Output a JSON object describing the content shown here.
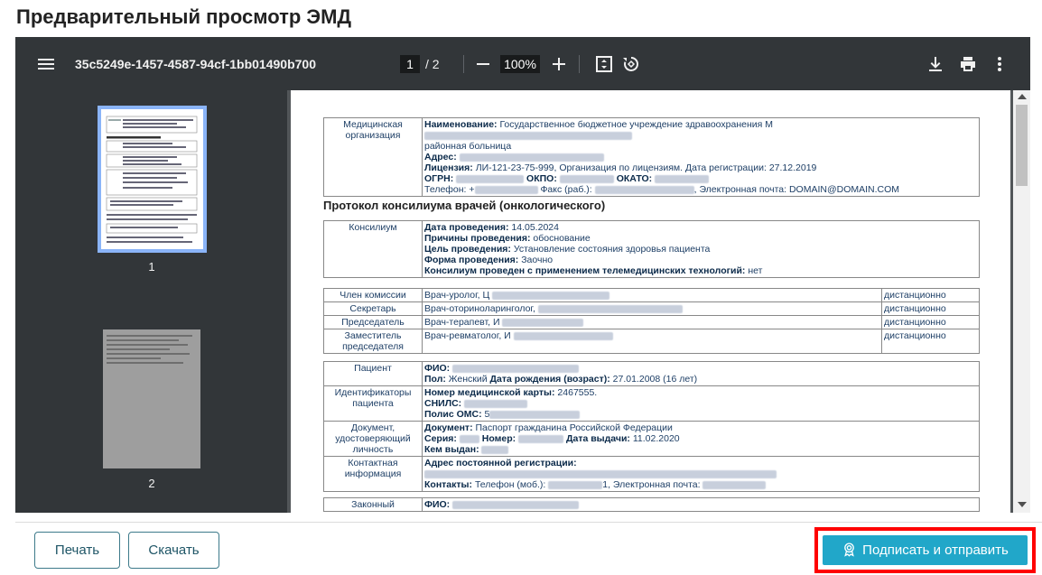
{
  "title": "Предварительный просмотр ЭМД",
  "viewer": {
    "doc_id": "35c5249e-1457-4587-94cf-1bb01490b700",
    "page_current": "1",
    "page_total": "/  2",
    "zoom": "100%"
  },
  "thumbnails": [
    {
      "label": "1",
      "selected": true
    },
    {
      "label": "2",
      "selected": false
    }
  ],
  "document": {
    "org": {
      "label": "Медицинская организация",
      "name_key": "Наименование:",
      "name_val": "Государственное бюджетное учреждение здравоохранения М",
      "name_val2": "районная больница",
      "address_key": "Адрес:",
      "license_key": "Лицензия:",
      "license_val": "ЛИ-121-23-75-999, Организация по лицензиям. Дата регистрации: 27.12.2019",
      "ogrn_key": "ОГРН:",
      "okpo_key": "ОКПО:",
      "okato_key": "ОКАТО:",
      "phone_text": "Телефон: +",
      "fax_text": "Факс (раб.):",
      "email_text": ", Электронная почта: DOMAIN@DOMAIN.COM"
    },
    "protocol_title": "Протокол консилиума врачей (онкологического)",
    "council": {
      "label": "Консилиум",
      "date_key": "Дата проведения:",
      "date_val": "14.05.2024",
      "reason_key": "Причины проведения:",
      "reason_val": "обоснование",
      "goal_key": "Цель проведения:",
      "goal_val": "Установление состояния здоровья пациента",
      "form_key": "Форма проведения:",
      "form_val": "Заочно",
      "telemed_key": "Консилиум проведен с применением телемедицинских технологий:",
      "telemed_val": "нет"
    },
    "members": [
      {
        "role": "Член комиссии",
        "doctor": "Врач-уролог, Ц",
        "mode": "дистанционно"
      },
      {
        "role": "Секретарь",
        "doctor": "Врач-оториноларинголог,",
        "mode": "дистанционно"
      },
      {
        "role": "Председатель",
        "doctor": "Врач-терапевт, И",
        "mode": "дистанционно"
      },
      {
        "role": "Заместитель председателя",
        "doctor": "Врач-ревматолог, И",
        "mode": "дистанционно"
      }
    ],
    "patient": {
      "label": "Пациент",
      "fio_key": "ФИО:",
      "sex_key": "Пол:",
      "sex_val": "Женский",
      "dob_key": "Дата рождения (возраст):",
      "dob_val": "27.01.2008 (16 лет)"
    },
    "identifiers": {
      "label": "Идентификаторы пациента",
      "card_key": "Номер медицинской карты:",
      "card_val": "2467555.",
      "snils_key": "СНИЛС:",
      "oms_key": "Полис ОМС:",
      "oms_val": "5"
    },
    "id_doc": {
      "label": "Документ, удостоверяющий личность",
      "doc_key": "Документ:",
      "doc_val": "Паспорт гражданина Российской Федерации",
      "series_key": "Серия:",
      "number_key": "Номер:",
      "issue_date_key": "Дата выдачи:",
      "issue_date_val": "11.02.2020",
      "issued_by_key": "Кем выдан:"
    },
    "contact": {
      "label": "Контактная информация",
      "address_key": "Адрес постоянной регистрации:",
      "contacts_key": "Контакты:",
      "contacts_val": "Телефон (моб.):",
      "contacts_tail": "1, Электронная почта:"
    },
    "legal_rep": {
      "label": "Законный",
      "fio_key": "ФИО:"
    }
  },
  "buttons": {
    "print": "Печать",
    "download": "Скачать",
    "sign": "Подписать и отправить"
  },
  "colors": {
    "accent": "#21a7c9",
    "highlight": "#ff0000",
    "toolbar": "#323639"
  }
}
